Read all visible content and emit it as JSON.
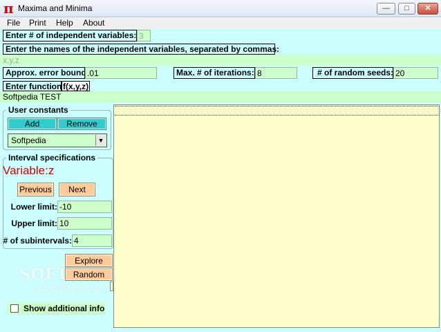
{
  "window": {
    "title": "Maxima and Minima",
    "icon": "pi-icon",
    "controls": {
      "minimize": "—",
      "maximize": "□",
      "close": "✕"
    }
  },
  "menu": [
    "File",
    "Print",
    "Help",
    "About"
  ],
  "form": {
    "num_vars_label": "Enter # of independent variables:",
    "num_vars_value": "3",
    "var_names_label": "Enter the names of the independent variables, separated by commas:",
    "var_names_value": "x,y,z",
    "error_bound_label": "Approx. error bound:",
    "error_bound_value": ".01",
    "max_iter_label": "Max. # of iterations:",
    "max_iter_value": "8",
    "seeds_label": "# of random seeds:",
    "seeds_value": "20",
    "function_label": "Enter function:",
    "function_sig": "f(x,y,z)",
    "function_value": "Softpedia TEST"
  },
  "user_constants": {
    "title": "User constants",
    "add_label": "Add",
    "remove_label": "Remove",
    "selected": "Softpedia"
  },
  "interval": {
    "title": "Interval specifications",
    "variable_label": "Variable:",
    "variable_value": "z",
    "previous_label": "Previous",
    "next_label": "Next",
    "lower_label": "Lower limit:",
    "lower_value": "-10",
    "upper_label": "Upper limit:",
    "upper_value": "10",
    "subintervals_label": "# of subintervals:",
    "subintervals_value": "4"
  },
  "actions": {
    "explore_label": "Explore",
    "random_label": "Random"
  },
  "show_info_label": "Show additional info",
  "watermark": {
    "main": "SOFTPEDIA",
    "sub": "www.softpedia.com"
  },
  "colors": {
    "panel": "#ccffff",
    "field": "#ccffcc",
    "output": "#ffffcc",
    "teal_button": "#33cccc",
    "orange_button": "#ffcc99",
    "variable": "#d40000"
  }
}
